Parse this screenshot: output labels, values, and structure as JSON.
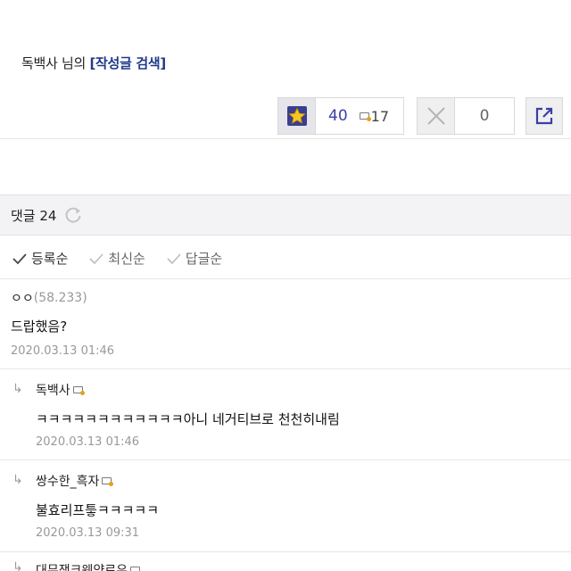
{
  "post": {
    "author_name": "독백사",
    "author_suffix": " 님의 ",
    "search_link": "[작성글 검색]"
  },
  "actions": {
    "recommend_count": "40",
    "fixed_count": "17",
    "dislike_count": "0"
  },
  "comments_section": {
    "title": "댓글 24"
  },
  "sort": {
    "options": [
      "등록순",
      "최신순",
      "답글순"
    ],
    "active": "등록순"
  },
  "comments": [
    {
      "nick": "ㅇㅇ",
      "ip": "(58.233)",
      "body": "드랍했음?",
      "date": "2020.03.13 01:46"
    },
    {
      "nick": "독백사",
      "body": "ㅋㅋㅋㅋㅋㅋㅋㅋㅋㅋㅋㅋ아니 네거티브로 천천히내림",
      "date": "2020.03.13 01:46"
    },
    {
      "nick": "쌍수한_흑자",
      "body": "불효리프틓ㅋㅋㅋㅋㅋ",
      "date": "2020.03.13 09:31"
    },
    {
      "nick": "대무쟁크웨약로우"
    }
  ],
  "colors": {
    "link": "#1f3a8a",
    "count": "#3b3fa8",
    "header_bg": "#f3f3f5"
  },
  "icons": [
    "star-icon",
    "fixed-icon",
    "x-icon",
    "share-icon",
    "refresh-icon",
    "check-icon",
    "reply-arrow-icon",
    "nick-badge-icon"
  ]
}
